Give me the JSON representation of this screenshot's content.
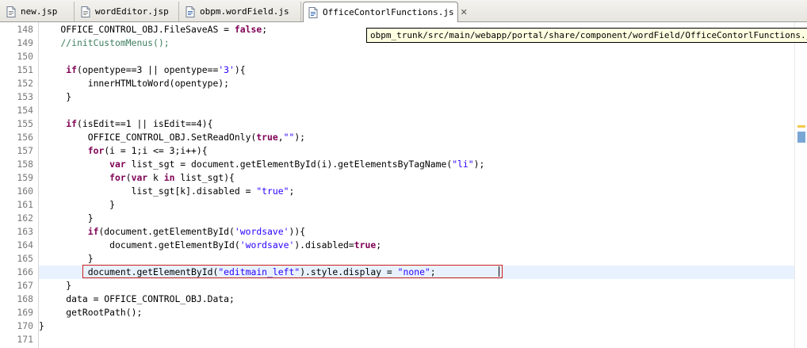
{
  "tabs": [
    {
      "label": "new.jsp",
      "icon": "jsp-file-icon",
      "active": false
    },
    {
      "label": "wordEditor.jsp",
      "icon": "jsp-file-icon",
      "active": false
    },
    {
      "label": "obpm.wordField.js",
      "icon": "js-file-icon",
      "active": false
    },
    {
      "label": "OfficeContorlFunctions.js",
      "icon": "js-file-icon",
      "active": true,
      "close": "✕"
    }
  ],
  "tooltip": "obpm_trunk/src/main/webapp/portal/share/component/wordField/OfficeContorlFunctions.js",
  "colors": {
    "keyword": "#7f0055",
    "string": "#2a00ff",
    "comment": "#3f7f5f",
    "current_line": "#e8f2fe",
    "highlight_box": "#cc2020"
  },
  "editor": {
    "lines": [
      {
        "no": "148",
        "parts": [
          {
            "t": "    OFFICE_CONTROL_OBJ.FileSaveAS = "
          },
          {
            "t": "false",
            "c": "kw"
          },
          {
            "t": ";"
          }
        ]
      },
      {
        "no": "149",
        "parts": [
          {
            "t": "    "
          },
          {
            "t": "//initCustomMenus();",
            "c": "cm"
          }
        ]
      },
      {
        "no": "150",
        "parts": [
          {
            "t": ""
          }
        ]
      },
      {
        "no": "151",
        "parts": [
          {
            "t": "     "
          },
          {
            "t": "if",
            "c": "kw"
          },
          {
            "t": "(opentype==3 || opentype=="
          },
          {
            "t": "'3'",
            "c": "str"
          },
          {
            "t": "){"
          }
        ]
      },
      {
        "no": "152",
        "parts": [
          {
            "t": "         innerHTMLtoWord(opentype);"
          }
        ]
      },
      {
        "no": "153",
        "parts": [
          {
            "t": "     }"
          }
        ]
      },
      {
        "no": "154",
        "parts": [
          {
            "t": ""
          }
        ]
      },
      {
        "no": "155",
        "parts": [
          {
            "t": "     "
          },
          {
            "t": "if",
            "c": "kw"
          },
          {
            "t": "(isEdit==1 || isEdit==4){"
          }
        ]
      },
      {
        "no": "156",
        "parts": [
          {
            "t": "         OFFICE_CONTROL_OBJ.SetReadOnly("
          },
          {
            "t": "true",
            "c": "kw"
          },
          {
            "t": ","
          },
          {
            "t": "\"\"",
            "c": "str"
          },
          {
            "t": ");"
          }
        ]
      },
      {
        "no": "157",
        "parts": [
          {
            "t": "         "
          },
          {
            "t": "for",
            "c": "kw"
          },
          {
            "t": "(i = 1;i <= 3;i++){"
          }
        ]
      },
      {
        "no": "158",
        "parts": [
          {
            "t": "             "
          },
          {
            "t": "var",
            "c": "kw"
          },
          {
            "t": " list_sgt = document.getElementById(i).getElementsByTagName("
          },
          {
            "t": "\"li\"",
            "c": "str"
          },
          {
            "t": ");"
          }
        ]
      },
      {
        "no": "159",
        "parts": [
          {
            "t": "             "
          },
          {
            "t": "for",
            "c": "kw"
          },
          {
            "t": "("
          },
          {
            "t": "var",
            "c": "kw"
          },
          {
            "t": " k "
          },
          {
            "t": "in",
            "c": "kw"
          },
          {
            "t": " list_sgt){"
          }
        ]
      },
      {
        "no": "160",
        "parts": [
          {
            "t": "                 list_sgt[k].disabled = "
          },
          {
            "t": "\"true\"",
            "c": "str"
          },
          {
            "t": ";"
          }
        ]
      },
      {
        "no": "161",
        "parts": [
          {
            "t": "             }"
          }
        ]
      },
      {
        "no": "162",
        "parts": [
          {
            "t": "         }"
          }
        ]
      },
      {
        "no": "163",
        "parts": [
          {
            "t": "         "
          },
          {
            "t": "if",
            "c": "kw"
          },
          {
            "t": "(document.getElementById("
          },
          {
            "t": "'wordsave'",
            "c": "str"
          },
          {
            "t": ")){"
          }
        ]
      },
      {
        "no": "164",
        "parts": [
          {
            "t": "             document.getElementById("
          },
          {
            "t": "'wordsave'",
            "c": "str"
          },
          {
            "t": ").disabled="
          },
          {
            "t": "true",
            "c": "kw"
          },
          {
            "t": ";"
          }
        ]
      },
      {
        "no": "165",
        "parts": [
          {
            "t": "         }"
          }
        ]
      },
      {
        "no": "166",
        "current": true,
        "parts": [
          {
            "t": "         document.getElementById("
          },
          {
            "t": "\"editmain_left\"",
            "c": "str"
          },
          {
            "t": ").style.display = "
          },
          {
            "t": "\"none\"",
            "c": "str"
          },
          {
            "t": ";"
          }
        ]
      },
      {
        "no": "167",
        "parts": [
          {
            "t": "     }"
          }
        ]
      },
      {
        "no": "168",
        "parts": [
          {
            "t": "     data = OFFICE_CONTROL_OBJ.Data;"
          }
        ]
      },
      {
        "no": "169",
        "parts": [
          {
            "t": "     getRootPath();"
          }
        ]
      },
      {
        "no": "170",
        "parts": [
          {
            "t": "}"
          }
        ]
      },
      {
        "no": "171",
        "parts": [
          {
            "t": ""
          }
        ]
      }
    ]
  }
}
